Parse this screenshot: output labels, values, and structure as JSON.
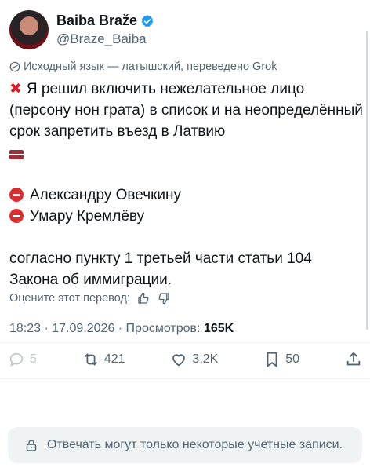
{
  "author": {
    "display_name": "Baiba Braže",
    "handle": "@Braze_Baiba"
  },
  "translation_note": "Исходный язык — латышский, переведено Grok",
  "tweet": {
    "line1": "Я решил включить нежелательное лицо (персону нон грата) в список и на неопределённый срок запретить въезд в Латвию",
    "person1": "Александру Овечкину",
    "person2": "Умару Кремлёву",
    "line3": "согласно пункту 1 третьей части статьи 104 Закона об иммиграции."
  },
  "rate_translation": "Оцените этот перевод:",
  "meta": {
    "time_date": "18:23 · 17.09.2026 · Просмотров:",
    "views": "165K"
  },
  "actions": {
    "reply_count": "5",
    "repost_count": "421",
    "like_count": "3,2K",
    "bookmark_count": "50"
  },
  "reply_restriction": "Отвечать могут только некоторые учетные записи.",
  "colors": {
    "verified": "#1d9bf0",
    "text": "#0f1419",
    "secondary": "#536471"
  }
}
